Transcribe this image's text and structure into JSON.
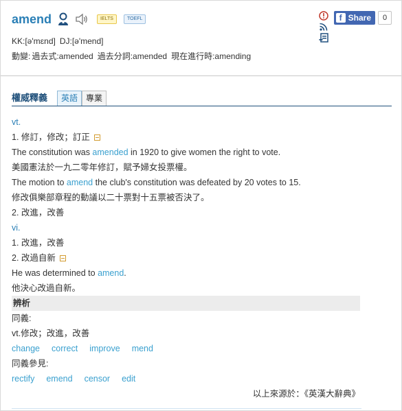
{
  "header": {
    "word": "amend",
    "exam_badges": [
      "IELTS",
      "TOEFL"
    ],
    "kk": "KK:[ə'mɛnd]",
    "dj": "DJ:[ə'mend]",
    "inflection_label": "動變:",
    "inflections": [
      "過去式:amended",
      "過去分詞:amended",
      "現在進行時:amending"
    ],
    "share_label": "Share",
    "share_count": "0",
    "icons": [
      "person-icon",
      "speaker-icon",
      "alert-icon",
      "rss-icon",
      "note-icon",
      "facebook-icon"
    ]
  },
  "tabs": {
    "title": "權威釋義",
    "items": [
      "英語",
      "專業"
    ],
    "active": "英語"
  },
  "content": {
    "pos_vt": "vt.",
    "def1": "1. 修訂，修改；訂正",
    "ex1_pre": "The constitution was ",
    "ex1_kw": "amended",
    "ex1_post": " in 1920 to give women the right to vote.",
    "ex1_zh": "美國憲法於一九二零年修訂，賦予婦女投票權。",
    "ex2_pre": "The motion to ",
    "ex2_kw": "amend",
    "ex2_post": " the club's constitution was defeated by 20 votes to 15.",
    "ex2_zh": "修改俱樂部章程的動議以二十票對十五票被否決了。",
    "def2": "2. 改進，改善",
    "pos_vi": "vi.",
    "vi_def1": "1. 改進，改善",
    "vi_def2": "2. 改過自新",
    "ex3_pre": "He was determined to ",
    "ex3_kw": "amend",
    "ex3_post": ".",
    "ex3_zh": "他決心改過自新。",
    "section_title": "辨析",
    "synonyms_label": "同義:",
    "synonyms_sense": "vt.修改；改進，改善",
    "synonyms": [
      "change",
      "correct",
      "improve",
      "mend"
    ],
    "see_also_label": "同義參見:",
    "see_also": [
      "rectify",
      "emend",
      "censor",
      "edit"
    ],
    "source": "以上來源於：《英漢大辭典》"
  },
  "colors": {
    "link": "#3aa0cf",
    "title": "#2a7fb6",
    "tab_title": "#1e4f7a",
    "facebook": "#4267b2"
  }
}
